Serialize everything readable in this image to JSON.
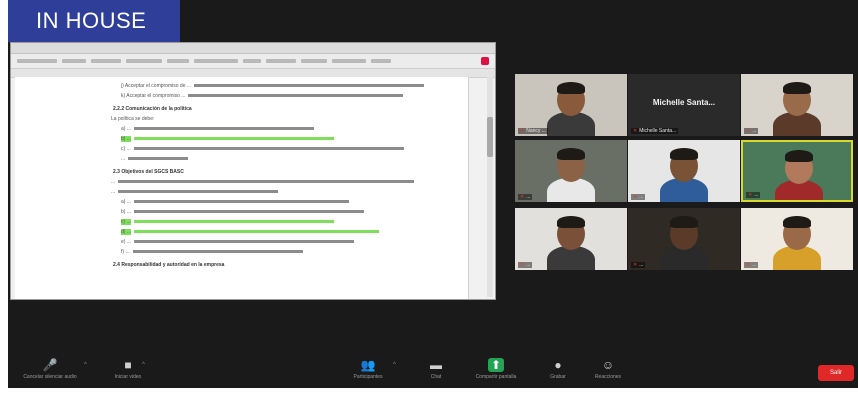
{
  "badge": {
    "label": "IN HOUSE"
  },
  "document": {
    "lines": [
      {
        "kind": "bullet",
        "text": "j)   Acceptar el compromiso de ...",
        "w": 230,
        "hl": false
      },
      {
        "kind": "bullet",
        "text": "k)   Acceptar el compromiso ...",
        "w": 215,
        "hl": false
      },
      {
        "kind": "head",
        "text": "2.2.2    Comunicación de la política",
        "w": 0,
        "hl": false
      },
      {
        "kind": "para",
        "text": "La política se debe:",
        "w": 0,
        "hl": false
      },
      {
        "kind": "bullet",
        "text": "a)   ...",
        "w": 180,
        "hl": false
      },
      {
        "kind": "bullet",
        "text": "b)   ...",
        "w": 200,
        "hl": true
      },
      {
        "kind": "bullet",
        "text": "c)   ...",
        "w": 270,
        "hl": false
      },
      {
        "kind": "bullet",
        "text": "     ...",
        "w": 60,
        "hl": false
      },
      {
        "kind": "head",
        "text": "2.3       Objetivos del SGCS BASC",
        "w": 0,
        "hl": false
      },
      {
        "kind": "para",
        "text": "...",
        "w": 296,
        "hl": false
      },
      {
        "kind": "para",
        "text": "...",
        "w": 160,
        "hl": false
      },
      {
        "kind": "bullet",
        "text": "a)   ...",
        "w": 215,
        "hl": false
      },
      {
        "kind": "bullet",
        "text": "b)   ...",
        "w": 230,
        "hl": false
      },
      {
        "kind": "bullet",
        "text": "c)   ...",
        "w": 200,
        "hl": true
      },
      {
        "kind": "bullet",
        "text": "d)   ...",
        "w": 245,
        "hl": true
      },
      {
        "kind": "bullet",
        "text": "e)   ...",
        "w": 220,
        "hl": false
      },
      {
        "kind": "bullet",
        "text": "f)   ...",
        "w": 170,
        "hl": false
      },
      {
        "kind": "head",
        "text": "2.4       Responsabilidad y autoridad en la empresa",
        "w": 0,
        "hl": false
      }
    ]
  },
  "gallery": {
    "tiles": [
      {
        "name": "Nancy ...",
        "big": "",
        "bg": "#c9c4bc",
        "skin": "#8a5a3c",
        "shirt": "#3a3a3a",
        "active": false
      },
      {
        "name": "Michelle Santa...",
        "big": "Michelle  Santa...",
        "bg": "#2a2a2a",
        "skin": "",
        "shirt": "",
        "active": false
      },
      {
        "name": "...",
        "big": "",
        "bg": "#d8d4cc",
        "skin": "#9a6b4a",
        "shirt": "#5b3a2a",
        "active": false
      },
      {
        "name": "...",
        "big": "",
        "bg": "#6a6f66",
        "skin": "#8c6246",
        "shirt": "#e8e8e8",
        "active": false
      },
      {
        "name": "...",
        "big": "",
        "bg": "#e6e6e6",
        "skin": "#7a5236",
        "shirt": "#2f5d9a",
        "active": false
      },
      {
        "name": "...",
        "big": "",
        "bg": "#4a7a5a",
        "skin": "#b27a5c",
        "shirt": "#a02a2a",
        "active": true
      },
      {
        "name": "...",
        "big": "",
        "bg": "#e2e0dc",
        "skin": "#7a5038",
        "shirt": "#3a3a3a",
        "active": false
      },
      {
        "name": "...",
        "big": "",
        "bg": "#2f2a24",
        "skin": "#5a3a28",
        "shirt": "#2a2a2a",
        "active": false
      },
      {
        "name": "...",
        "big": "",
        "bg": "#eeeae2",
        "skin": "#9a6a48",
        "shirt": "#d6a02a",
        "active": false
      }
    ]
  },
  "controls": [
    {
      "id": "mute",
      "icon": "🎤",
      "label": "Cancelar silenciar audio",
      "green": false
    },
    {
      "id": "video",
      "icon": "■",
      "label": "Iniciar video",
      "green": false
    },
    {
      "id": "participants",
      "icon": "👥",
      "label": "Participantes",
      "green": false
    },
    {
      "id": "chat",
      "icon": "▬",
      "label": "Chat",
      "green": false
    },
    {
      "id": "share",
      "icon": "⬆",
      "label": "Compartir pantalla",
      "green": true
    },
    {
      "id": "record",
      "icon": "●",
      "label": "Grabar",
      "green": false
    },
    {
      "id": "reactions",
      "icon": "☺",
      "label": "Reacciones",
      "green": false
    }
  ],
  "end": {
    "label": "Salir"
  },
  "colors": {
    "badge": "#2f3e98",
    "highlight": "#7ee05a",
    "active_border": "#d8d92a",
    "end": "#e02828",
    "share_green": "#23a455"
  }
}
